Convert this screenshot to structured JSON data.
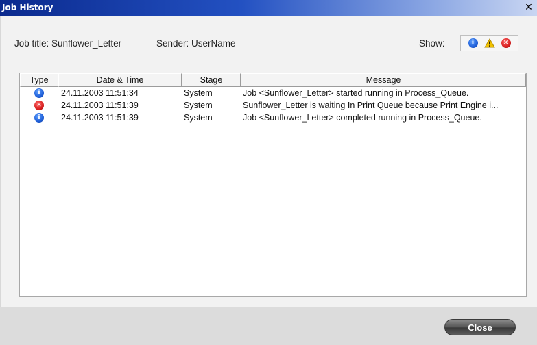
{
  "window": {
    "title": "Job History"
  },
  "info": {
    "job_title": "Job title: Sunflower_Letter",
    "sender": "Sender: UserName",
    "show_label": "Show:"
  },
  "filters": [
    {
      "name": "info",
      "icon": "info-icon",
      "symbol": "i"
    },
    {
      "name": "warning",
      "icon": "warning-icon",
      "symbol": "!"
    },
    {
      "name": "error",
      "icon": "error-icon",
      "symbol": "✕"
    }
  ],
  "table": {
    "columns": [
      "Type",
      "Date & Time",
      "Stage",
      "Message"
    ],
    "rows": [
      {
        "type": "info",
        "datetime": "24.11.2003 11:51:34",
        "stage": "System",
        "message": "Job <Sunflower_Letter> started running in Process_Queue."
      },
      {
        "type": "error",
        "datetime": "24.11.2003 11:51:39",
        "stage": "System",
        "message": "Sunflower_Letter is waiting In Print Queue because Print Engine i..."
      },
      {
        "type": "info",
        "datetime": "24.11.2003 11:51:39",
        "stage": "System",
        "message": "Job <Sunflower_Letter> completed running in Process_Queue."
      }
    ]
  },
  "footer": {
    "close_label": "Close"
  },
  "colors": {
    "info": "#1f5fd8",
    "warning": "#f2c200",
    "error": "#d81f1f",
    "title_bar": "#0b2a8e"
  }
}
